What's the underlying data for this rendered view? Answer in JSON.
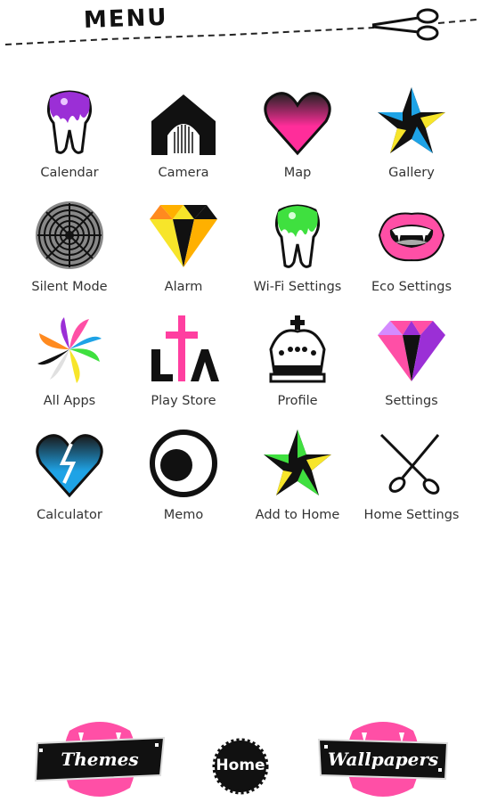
{
  "header": {
    "title": "MENU",
    "scissors_icon": "scissors-icon"
  },
  "apps": [
    {
      "label": "Calendar",
      "icon": "tooth-purple-icon"
    },
    {
      "label": "Camera",
      "icon": "house-camera-icon"
    },
    {
      "label": "Map",
      "icon": "heart-pink-icon"
    },
    {
      "label": "Gallery",
      "icon": "nautical-star-icon"
    },
    {
      "label": "Silent Mode",
      "icon": "op-art-circle-icon"
    },
    {
      "label": "Alarm",
      "icon": "diamond-triangles-icon"
    },
    {
      "label": "Wi-Fi Settings",
      "icon": "tooth-green-icon"
    },
    {
      "label": "Eco Settings",
      "icon": "vampire-lips-icon"
    },
    {
      "label": "All Apps",
      "icon": "pinwheel-icon"
    },
    {
      "label": "Play Store",
      "icon": "cross-lia-icon"
    },
    {
      "label": "Profile",
      "icon": "crown-icon"
    },
    {
      "label": "Settings",
      "icon": "gem-pink-icon"
    },
    {
      "label": "Calculator",
      "icon": "broken-heart-icon"
    },
    {
      "label": "Memo",
      "icon": "eye-circle-icon"
    },
    {
      "label": "Add to Home",
      "icon": "star-green-icon"
    },
    {
      "label": "Home Settings",
      "icon": "scissors-icon"
    }
  ],
  "bottom": {
    "themes_label": "Themes",
    "home_label": "Home",
    "wallpapers_label": "Wallpapers"
  },
  "colors": {
    "pink": "#ff3fa0",
    "purple": "#9b2fd6",
    "green": "#3fe03f",
    "blue": "#1ea3e6",
    "yellow": "#f7e52a",
    "black": "#111111"
  }
}
